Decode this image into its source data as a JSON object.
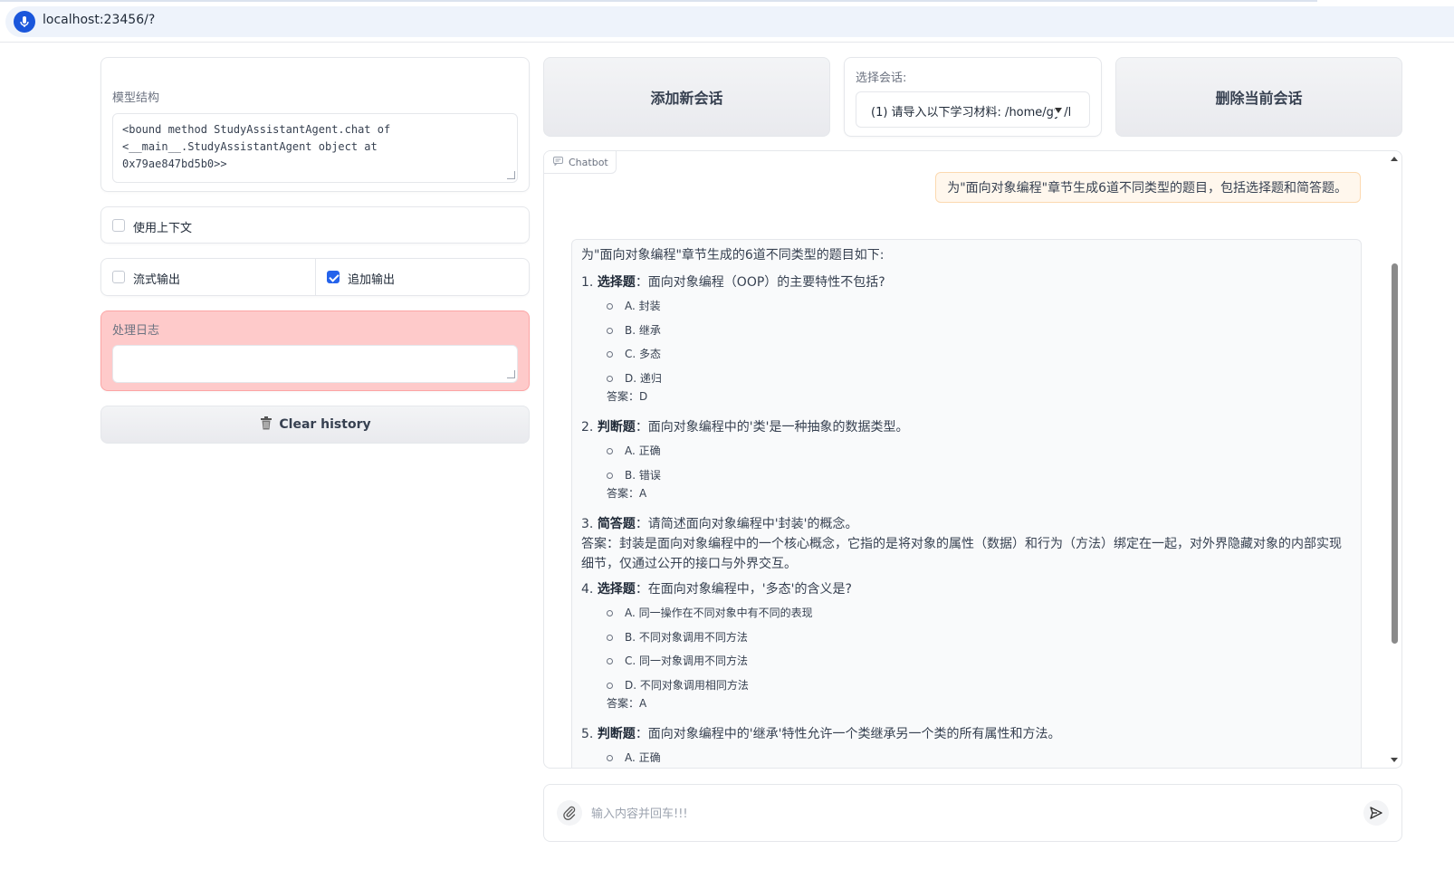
{
  "browser": {
    "url": "localhost:23456/?"
  },
  "model_panel": {
    "label": "模型结构",
    "value": "<bound method StudyAssistantAgent.chat of\n<__main__.StudyAssistantAgent object at\n0x79ae847bd5b0>>"
  },
  "use_context": {
    "label": "使用上下文",
    "checked": false
  },
  "stream_output": {
    "label": "流式输出",
    "checked": false
  },
  "append_output": {
    "label": "追加输出",
    "checked": true
  },
  "log_panel": {
    "label": "处理日志",
    "value": ""
  },
  "clear_history": {
    "label": "Clear history",
    "icon": "trash-icon"
  },
  "session": {
    "add_label": "添加新会话",
    "select_label": "选择会话:",
    "selected": "(1) 请导入以下学习材料: /home/gyl/l",
    "delete_label": "删除当前会话"
  },
  "chatbot": {
    "tag": "Chatbot",
    "user_message": "为\"面向对象编程\"章节生成6道不同类型的题目，包括选择题和简答题。",
    "bot_intro": "为\"面向对象编程\"章节生成的6道不同类型的题目如下:",
    "questions": [
      {
        "num": "1.",
        "type": "选择题",
        "text": "：面向对象编程（OOP）的主要特性不包括?",
        "options": [
          "A. 封装",
          "B. 继承",
          "C. 多态",
          "D. 递归"
        ],
        "answer": "答案：D"
      },
      {
        "num": "2.",
        "type": "判断题",
        "text": "：面向对象编程中的'类'是一种抽象的数据类型。",
        "options": [
          "A. 正确",
          "B. 错误"
        ],
        "answer": "答案：A"
      },
      {
        "num": "3.",
        "type": "简答题",
        "text": "：请简述面向对象编程中'封装'的概念。",
        "answer_long": "答案：封装是面向对象编程中的一个核心概念，它指的是将对象的属性（数据）和行为（方法）绑定在一起，对外界隐藏对象的内部实现细节，仅通过公开的接口与外界交互。"
      },
      {
        "num": "4.",
        "type": "选择题",
        "text": "：在面向对象编程中，'多态'的含义是?",
        "options": [
          "A. 同一操作在不同对象中有不同的表现",
          "B. 不同对象调用不同方法",
          "C. 同一对象调用不同方法",
          "D. 不同对象调用相同方法"
        ],
        "answer": "答案：A"
      },
      {
        "num": "5.",
        "type": "判断题",
        "text": "：面向对象编程中的'继承'特性允许一个类继承另一个类的所有属性和方法。",
        "options": [
          "A. 正确"
        ]
      }
    ]
  },
  "input": {
    "placeholder": "输入内容并回车!!!"
  }
}
